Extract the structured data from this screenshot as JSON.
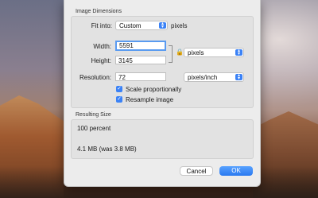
{
  "dimensions": {
    "title": "Image Dimensions",
    "fit_into_label": "Fit into:",
    "fit_into_value": "Custom",
    "fit_into_unit": "pixels",
    "width_label": "Width:",
    "width_value": "5591",
    "height_label": "Height:",
    "height_value": "3145",
    "size_unit": "pixels",
    "resolution_label": "Resolution:",
    "resolution_value": "72",
    "resolution_unit": "pixels/inch",
    "scale_label": "Scale proportionally",
    "resample_label": "Resample image"
  },
  "result": {
    "title": "Resulting Size",
    "percent": "100 percent",
    "size": "4.1 MB (was 3.8 MB)"
  },
  "buttons": {
    "cancel": "Cancel",
    "ok": "OK"
  }
}
